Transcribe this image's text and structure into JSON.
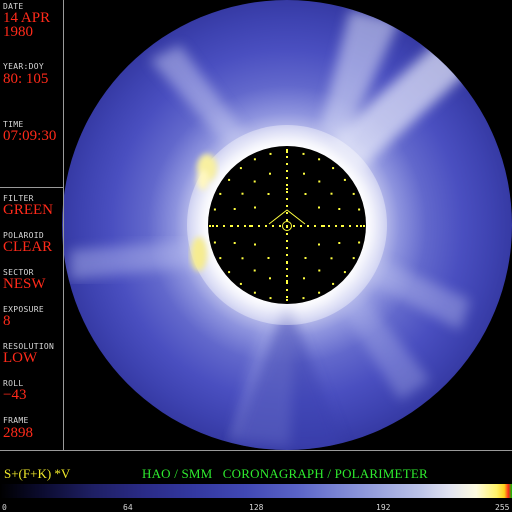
{
  "sidebar": {
    "fields": [
      {
        "label": "DATE",
        "value": "14 APR",
        "value2": "1980"
      },
      {
        "label": "YEAR:DOY",
        "value": "80: 105"
      },
      {
        "label": "TIME",
        "value": "07:09:30"
      },
      {
        "label": "FILTER",
        "value": "GREEN"
      },
      {
        "label": "POLAROID",
        "value": "CLEAR"
      },
      {
        "label": "SECTOR",
        "value": "NESW"
      },
      {
        "label": "EXPOSURE",
        "value": "8"
      },
      {
        "label": "RESOLUTION",
        "value": "LOW"
      },
      {
        "label": "ROLL",
        "value": "−43"
      },
      {
        "label": "FRAME",
        "value": "2898"
      }
    ]
  },
  "footer": {
    "formula": "S+(F+K) *V",
    "banner": "HAO / SMM   CORONAGRAPH / POLARIMETER",
    "colorbar_ticks": [
      "0",
      "64",
      "128",
      "192",
      "255"
    ]
  },
  "colors": {
    "value_text": "#ff2a1a",
    "label_text": "#d8d8d8",
    "banner_text": "#2eea2e",
    "formula_text": "#f2ea2a",
    "corona_blue": "#4a4fc0",
    "occulter": "#000000",
    "grid_dots": "#ffff40"
  }
}
